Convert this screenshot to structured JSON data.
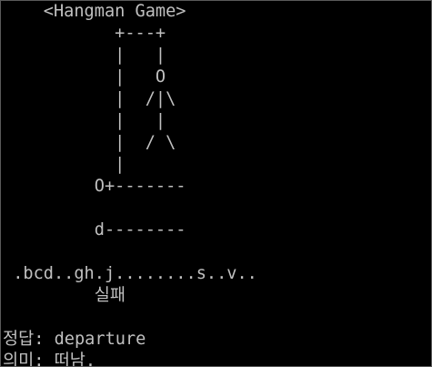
{
  "window": {
    "background": "#000000",
    "foreground": "#c0c0c0"
  },
  "console": {
    "lines": [
      "    <Hangman Game>",
      "           +---+",
      "           |   |",
      "           |   O",
      "           |  /|\\",
      "           |   |",
      "           |  / \\",
      "           |",
      "         O+-------",
      "",
      "         d--------",
      "",
      " .bcd..gh.j........s..v..",
      "         실패",
      "",
      "정답: departure",
      "의미: 떠남."
    ]
  }
}
